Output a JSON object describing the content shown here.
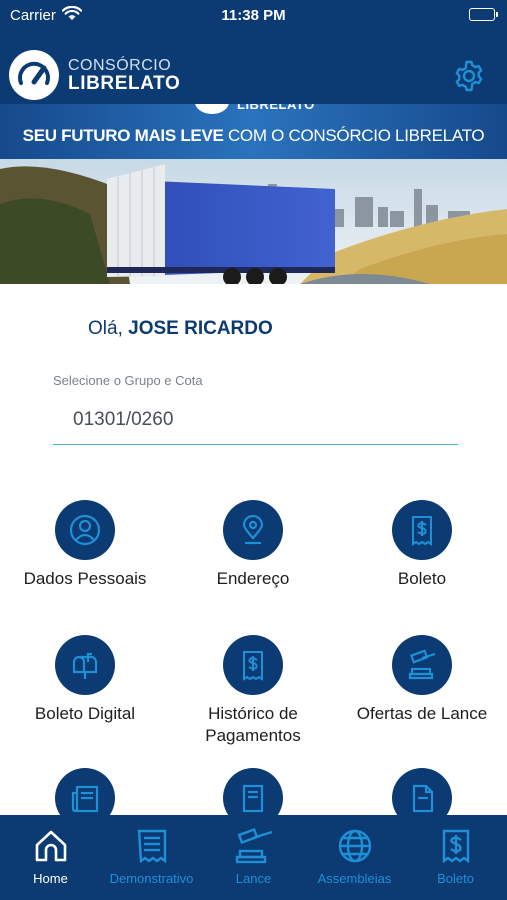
{
  "status_bar": {
    "carrier": "Carrier",
    "time": "11:38 PM"
  },
  "header": {
    "logo_line1": "CONSÓRCIO",
    "logo_line2": "LIBRELATO",
    "settings_icon": "gear-icon"
  },
  "banner": {
    "logo_text": "LIBRELATO",
    "slogan_bold": "SEU FUTURO MAIS LEVE",
    "slogan_rest": " COM O CONSÓRCIO LIBRELATO"
  },
  "greeting": {
    "prefix": "Olá, ",
    "name": "JOSE RICARDO"
  },
  "group_select": {
    "label": "Selecione o Grupo e Cota",
    "value": "01301/0260"
  },
  "menu": [
    {
      "label": "Dados Pessoais",
      "icon": "person-icon"
    },
    {
      "label": "Endereço",
      "icon": "location-pin-icon"
    },
    {
      "label": "Boleto",
      "icon": "dollar-receipt-icon"
    },
    {
      "label": "Boleto Digital",
      "icon": "mailbox-icon"
    },
    {
      "label": "Histórico de\nPagamentos",
      "icon": "dollar-receipt-icon"
    },
    {
      "label": "Ofertas de Lance",
      "icon": "gavel-icon"
    },
    {
      "label": "",
      "icon": "newspaper-icon"
    },
    {
      "label": "",
      "icon": "document-list-icon"
    },
    {
      "label": "",
      "icon": "document-icon"
    }
  ],
  "tabs": [
    {
      "label": "Home",
      "icon": "home-icon",
      "active": true
    },
    {
      "label": "Demonstrativo",
      "icon": "receipt-list-icon",
      "active": false
    },
    {
      "label": "Lance",
      "icon": "gavel-icon",
      "active": false
    },
    {
      "label": "Assembleias",
      "icon": "globe-icon",
      "active": false
    },
    {
      "label": "Boleto",
      "icon": "dollar-receipt-icon",
      "active": false
    }
  ],
  "colors": {
    "primary": "#0c3a72",
    "accent": "#1f8fd6",
    "underline": "#4fb3cf"
  }
}
